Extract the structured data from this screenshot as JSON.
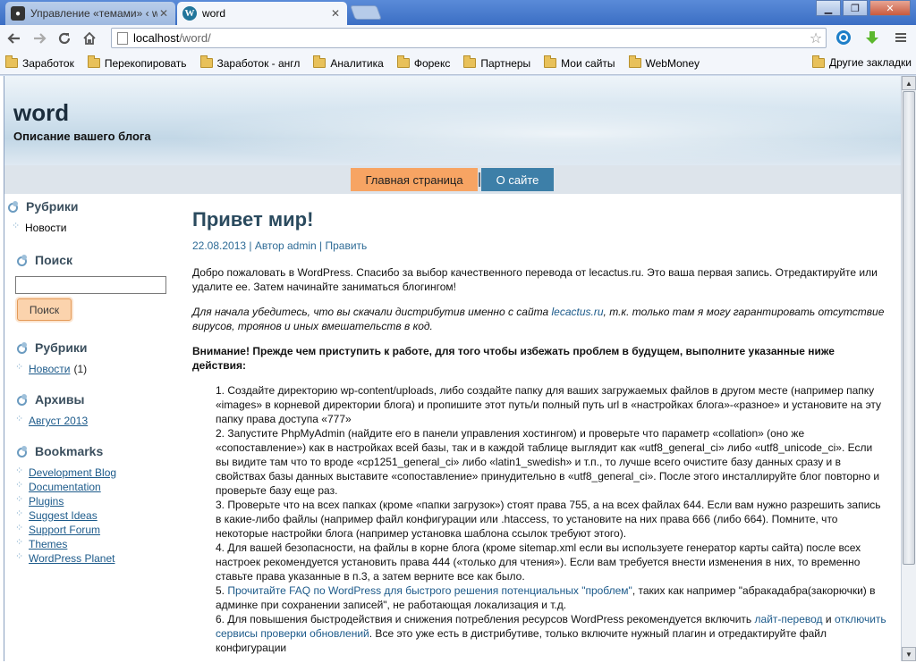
{
  "browser": {
    "tabs": [
      {
        "title": "Управление «темами» ‹ wo",
        "active": false
      },
      {
        "title": "word",
        "active": true
      }
    ],
    "window_controls": {
      "minimize": "▁",
      "maximize": "❐",
      "close": "✕"
    },
    "address": {
      "host": "localhost",
      "path": "/word/"
    },
    "bookmarks": [
      "Заработок",
      "Перекопировать",
      "Заработок - англ",
      "Аналитика",
      "Форекс",
      "Партнеры",
      "Мои сайты",
      "WebMoney"
    ],
    "other_bookmarks": "Другие закладки",
    "accent": "#3b6ec4"
  },
  "site": {
    "title": "word",
    "description": "Описание вашего блога"
  },
  "menu": {
    "home": "Главная страница",
    "about": "О сайте"
  },
  "sidebar": {
    "rubrics_top": {
      "title": "Рубрики",
      "item": "Новости"
    },
    "search": {
      "title": "Поиск",
      "button": "Поиск",
      "value": ""
    },
    "rubrics": {
      "title": "Рубрики",
      "item": "Новости",
      "count": "(1)"
    },
    "archives": {
      "title": "Архивы",
      "item": "Август 2013"
    },
    "bookmarks": {
      "title": "Bookmarks",
      "items": [
        "Development Blog",
        "Documentation",
        "Plugins",
        "Suggest Ideas",
        "Support Forum",
        "Themes",
        "WordPress Planet"
      ]
    }
  },
  "post": {
    "title": "Привет мир!",
    "meta": "22.08.2013 | Автор admin | Править",
    "p1": "Добро пожаловать в WordPress. Спасибо за выбор качественного перевода от lecactus.ru. Это ваша первая запись. Отредактируйте или удалите ее. Затем начинайте заниматься блогингом!",
    "p2_before": "Для начала убедитесь, что вы скачали дистрибутив именно с сайта ",
    "p2_link": "lecactus.ru",
    "p2_after": ", т.к. только там я могу гарантировать отсутствие вирусов, троянов и иных вмешательств в код.",
    "warning": "Внимание! Прежде чем приступить к работе, для того чтобы избежать проблем в будущем, выполните указанные ниже действия:",
    "step1": "1. Создайте директорию wp-content/uploads, либо создайте папку для ваших загружаемых файлов в другом месте (например папку «images» в корневой директории блога) и пропишите этот путь/и полный путь url в «настройках блога»-«разное» и установите на эту папку права доступа «777»",
    "step2": "2. Запустите PhpMyAdmin (найдите его в панели управления хостингом) и проверьте что параметр «collation» (оно же «сопоставление») как в настройках всей базы, так и в каждой таблице выглядит как «utf8_general_ci» либо «utf8_unicode_ci». Если вы видите там что то вроде «cp1251_general_ci» либо «latin1_swedish» и т.п., то лучше всего очистите базу данных сразу и в свойствах базы данных выставите «сопоставление» принудительно в «utf8_general_ci». После этого инсталлируйте блог повторно и проверьте базу еще раз.",
    "step3": "3. Проверьте что на всех папках (кроме «папки загрузок») стоят права 755, а на всех файлах 644. Если вам нужно разрешить запись в какие-либо файлы (например файл конфигурации или .htaccess, то установите на них права 666 (либо 664). Помните, что некоторые настройки блога (например установка шаблона ссылок требуют этого).",
    "step4": "4. Для вашей безопасности, на файлы в корне блога (кроме sitemap.xml если вы используете генератор карты сайта) после всех настроек рекомендуется установить права 444 («только для чтения»). Если вам требуется внести изменения в них, то временно ставьте права указанные в п.3, а затем верните все как было.",
    "step5_prefix": "5. ",
    "step5_link": "Прочитайте FAQ по WordPress для быстрого решения потенциальных \"проблем\"",
    "step5_after": ", таких как например \"абракадабра(закорючки) в админке при сохранении записей\", не работающая локализация и т.д.",
    "step6_before": "6. Для повышения быстродействия и снижения потребления ресурсов WordPress рекомендуется включить ",
    "step6_link1": "лайт-перевод",
    "step6_mid": " и ",
    "step6_link2": "отключить сервисы проверки обновлений",
    "step6_after": ". Все это уже есть в дистрибутиве, только включите нужный плагин и отредактируйте файл конфигурации"
  }
}
